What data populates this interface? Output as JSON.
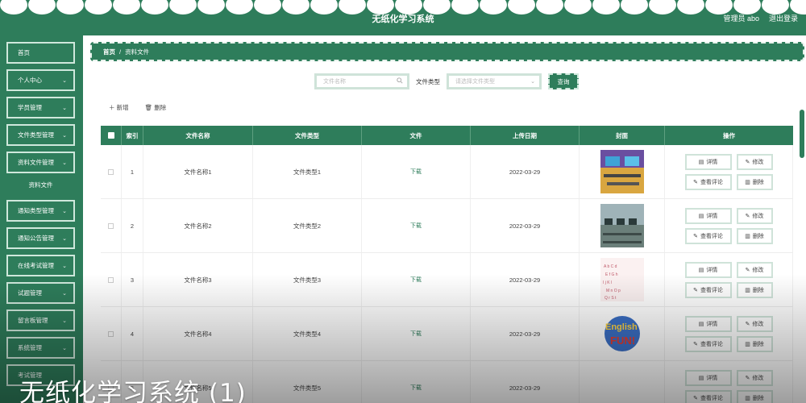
{
  "header": {
    "title": "无纸化学习系统",
    "user": "管理员 abo",
    "logout": "退出登录"
  },
  "sidebar": {
    "items": [
      {
        "label": "首页",
        "expandable": false
      },
      {
        "label": "个人中心",
        "expandable": true
      },
      {
        "label": "学员管理",
        "expandable": true
      },
      {
        "label": "文件类型管理",
        "expandable": true
      },
      {
        "label": "资料文件管理",
        "expandable": true
      },
      {
        "label": "通知类型管理",
        "expandable": true
      },
      {
        "label": "通知公告管理",
        "expandable": true
      },
      {
        "label": "在线考试管理",
        "expandable": true
      },
      {
        "label": "试题管理",
        "expandable": true
      },
      {
        "label": "留言板管理",
        "expandable": true
      },
      {
        "label": "系统管理",
        "expandable": true
      },
      {
        "label": "考试管理",
        "expandable": false
      }
    ],
    "subitem": "资料文件"
  },
  "breadcrumb": {
    "home": "首页",
    "sep": "/",
    "current": "资料文件"
  },
  "search": {
    "name_placeholder": "文件名称",
    "type_label": "文件类型",
    "type_placeholder": "请选择文件类型",
    "query": "查询"
  },
  "actions": {
    "add": "新增",
    "delete": "删除"
  },
  "table": {
    "headers": [
      "索引",
      "文件名称",
      "文件类型",
      "文件",
      "上传日期",
      "封面",
      "操作"
    ],
    "rows": [
      {
        "index": "1",
        "name": "文件名称1",
        "type": "文件类型1",
        "file": "下载",
        "date": "2022-03-29",
        "cover": "classroom-photo"
      },
      {
        "index": "2",
        "name": "文件名称2",
        "type": "文件类型2",
        "file": "下载",
        "date": "2022-03-29",
        "cover": "computer-lab-photo"
      },
      {
        "index": "3",
        "name": "文件名称3",
        "type": "文件类型3",
        "file": "下载",
        "date": "2022-03-29",
        "cover": "letters-illustration"
      },
      {
        "index": "4",
        "name": "文件名称4",
        "type": "文件类型4",
        "file": "下载",
        "date": "2022-03-29",
        "cover": "english-fun-illustration"
      },
      {
        "index": "5",
        "name": "文件名称5",
        "type": "文件类型5",
        "file": "下载",
        "date": "2022-03-29",
        "cover": ""
      }
    ],
    "ops": {
      "detail": "详情",
      "edit": "修改",
      "comments": "查看评论",
      "delete": "删除"
    }
  },
  "caption": "无纸化学习系统 (1)",
  "colors": {
    "primary": "#2e7d5b",
    "border_light": "#cfe3d9"
  }
}
